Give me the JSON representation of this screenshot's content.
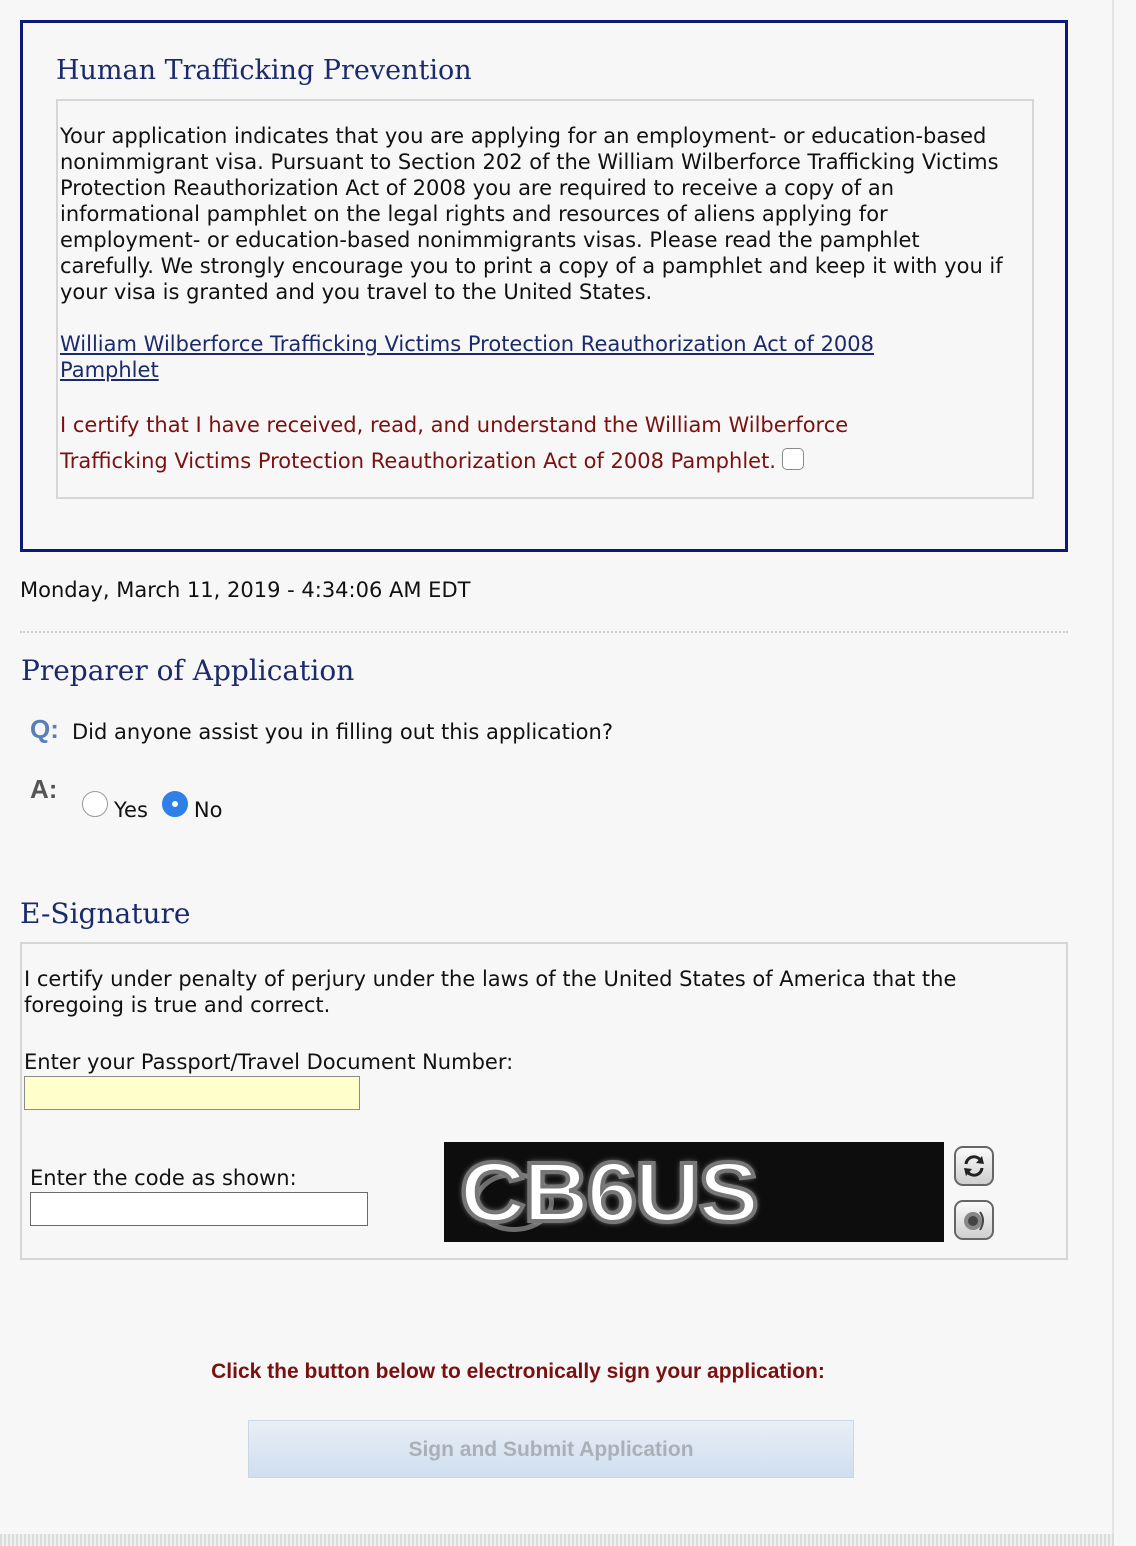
{
  "trafficking": {
    "title": "Human Trafficking Prevention",
    "body": "Your application indicates that you are applying for an employment- or education-based nonimmigrant visa. Pursuant to Section 202 of the William Wilberforce Trafficking Victims Protection Reauthorization Act of 2008 you are required to receive a copy of an informational pamphlet on the legal rights and resources of aliens applying for employment- or education-based nonimmigrants visas. Please read the pamphlet carefully. We strongly encourage you to print a copy of a pamphlet and keep it with you if your visa is granted and you travel to the United States.",
    "pamphlet_link": "William Wilberforce Trafficking Victims Protection Reauthorization Act of 2008 Pamphlet",
    "certify_text": "I certify that I have received, read, and understand the William Wilberforce Trafficking Victims Protection Reauthorization Act of 2008 Pamphlet.",
    "certify_checked": false
  },
  "timestamp": "Monday, March 11, 2019 - 4:34:06 AM EDT",
  "preparer": {
    "title": "Preparer of Application",
    "q_label": "Q:",
    "question": "Did anyone assist you in filling out this application?",
    "a_label": "A:",
    "options": [
      {
        "label": "Yes",
        "selected": false
      },
      {
        "label": "No",
        "selected": true
      }
    ]
  },
  "esignature": {
    "title": "E-Signature",
    "certify_text": "I certify under penalty of perjury under the laws of the United States of America that the foregoing is true and correct.",
    "passport_label": "Enter your Passport/Travel Document Number:",
    "passport_value": "",
    "code_label": "Enter the code as shown:",
    "code_value": "",
    "captcha_text": "CB6US",
    "refresh_icon": "refresh-icon",
    "audio_icon": "speaker-icon"
  },
  "submit": {
    "instruction": "Click the button below to electronically sign your application:",
    "button_label": "Sign and Submit Application"
  },
  "colors": {
    "heading_navy": "#1b2a6b",
    "box_border": "#0b1a7a",
    "certify_red": "#7a1010",
    "radio_selected": "#2f7fe8",
    "input_highlight": "#ffffcc"
  }
}
